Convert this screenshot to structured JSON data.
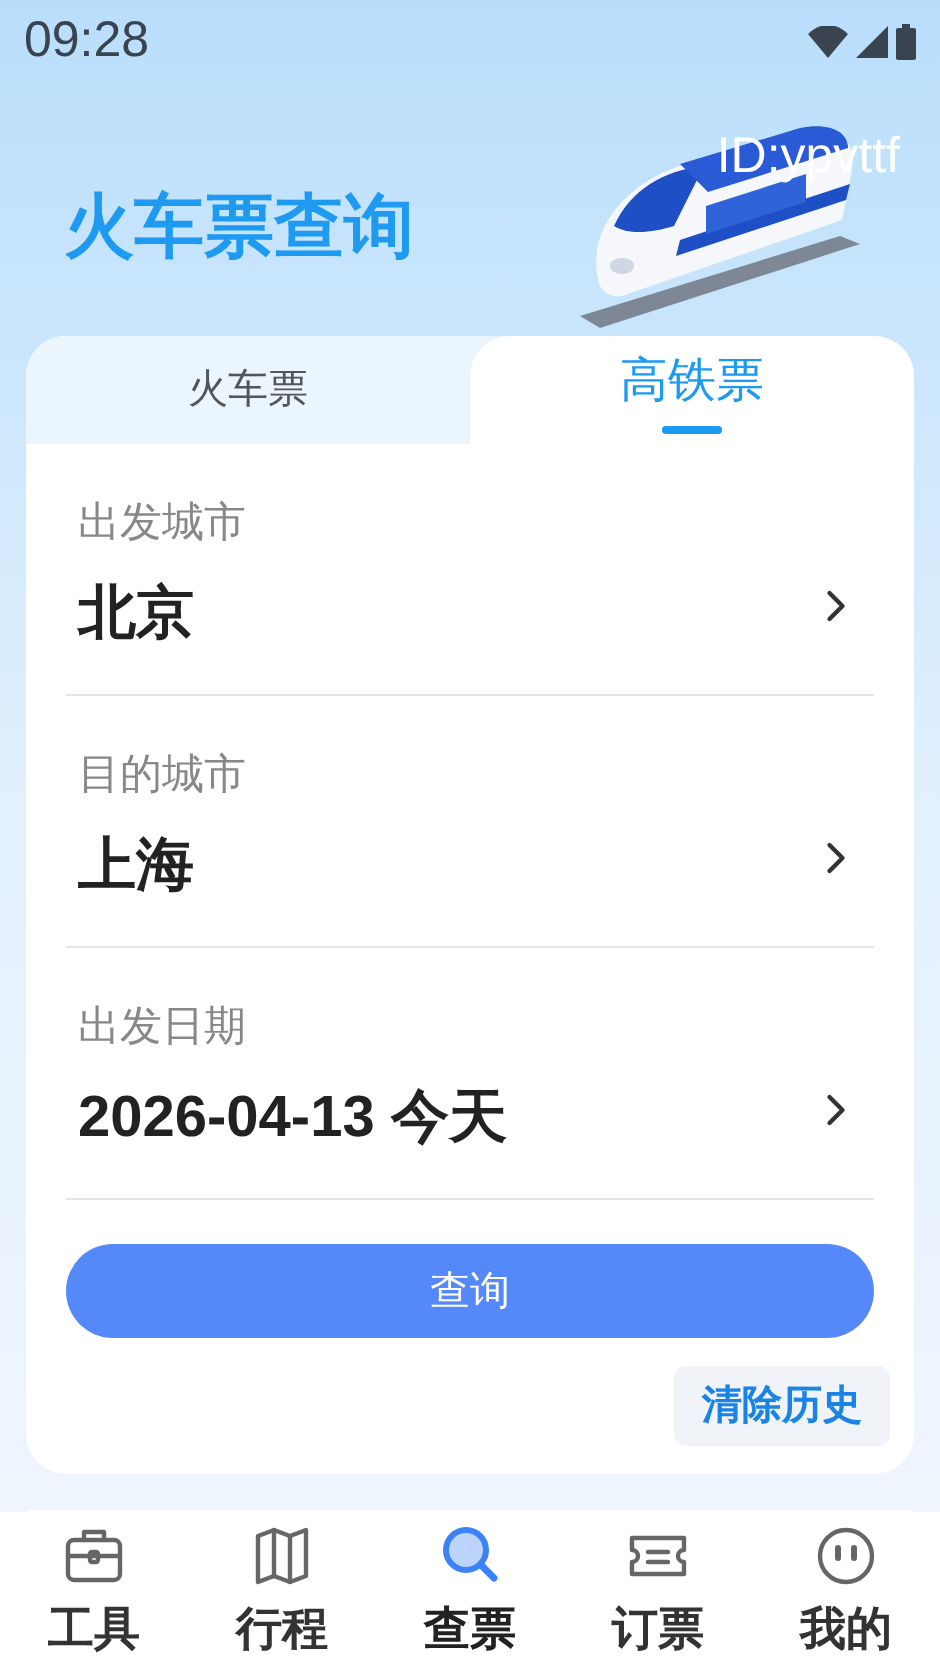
{
  "status_bar": {
    "time": "09:28"
  },
  "header": {
    "title": "火车票查询",
    "id_label": "ID:ypvttf"
  },
  "tabs": [
    {
      "label": "火车票",
      "selected": false
    },
    {
      "label": "高铁票",
      "selected": true
    }
  ],
  "fields": [
    {
      "label": "出发城市",
      "value": "北京"
    },
    {
      "label": "目的城市",
      "value": "上海"
    },
    {
      "label": "出发日期",
      "value": "2026-04-13 今天"
    }
  ],
  "search_button": "查询",
  "clear_history_button": "清除历史",
  "bottom_nav": [
    {
      "label": "工具",
      "kind": "toolbox",
      "selected": false
    },
    {
      "label": "行程",
      "kind": "map",
      "selected": false
    },
    {
      "label": "查票",
      "kind": "search",
      "selected": true
    },
    {
      "label": "订票",
      "kind": "ticket",
      "selected": false
    },
    {
      "label": "我的",
      "kind": "face",
      "selected": false
    }
  ]
}
